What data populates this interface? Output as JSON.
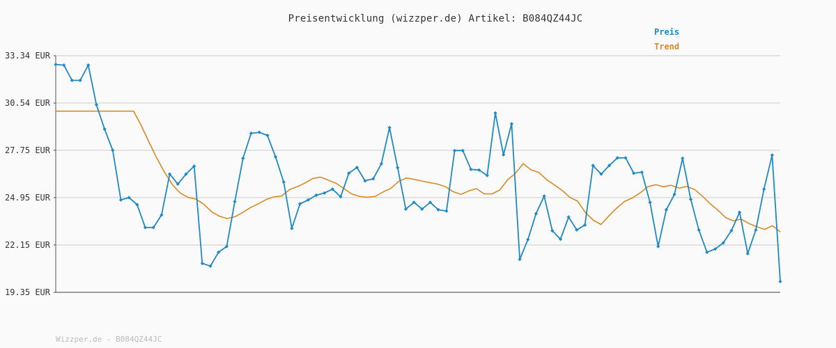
{
  "chart_data": {
    "type": "line",
    "title": "Preisentwicklung (wizzper.de) Artikel: B084QZ44JC",
    "ylim": [
      19.35,
      33.34
    ],
    "y_ticks": [
      "33.34 EUR",
      "30.54 EUR",
      "27.75 EUR",
      "24.95 EUR",
      "22.15 EUR",
      "19.35 EUR"
    ],
    "y_tick_values": [
      33.34,
      30.54,
      27.75,
      24.95,
      22.15,
      19.35
    ],
    "grid": true,
    "legend_position": "top-right",
    "series": [
      {
        "name": "Preis",
        "color": "#1f88c7",
        "marker": "diamond",
        "values": [
          32.82,
          32.78,
          31.88,
          31.88,
          32.78,
          30.44,
          29.0,
          27.75,
          24.81,
          24.95,
          24.53,
          23.18,
          23.18,
          23.92,
          26.34,
          25.75,
          26.34,
          26.81,
          21.06,
          20.9,
          21.72,
          22.06,
          24.72,
          27.27,
          28.75,
          28.81,
          28.63,
          27.36,
          25.87,
          23.13,
          24.58,
          24.81,
          25.09,
          25.22,
          25.45,
          25.0,
          26.39,
          26.73,
          25.94,
          26.06,
          26.95,
          29.09,
          26.72,
          24.27,
          24.67,
          24.27,
          24.67,
          24.23,
          24.16,
          27.73,
          27.73,
          26.62,
          26.58,
          26.26,
          29.95,
          27.48,
          29.31,
          21.3,
          22.47,
          24.0,
          25.04,
          22.99,
          22.49,
          23.8,
          23.04,
          23.33,
          26.85,
          26.34,
          26.85,
          27.3,
          27.3,
          26.39,
          26.45,
          24.67,
          22.06,
          24.23,
          25.14,
          27.27,
          24.85,
          23.04,
          21.72,
          21.91,
          22.27,
          23.0,
          24.08,
          21.64,
          23.04,
          25.45,
          27.46,
          19.99
        ]
      },
      {
        "name": "Trend",
        "color": "#d98a25",
        "marker": "none",
        "values": [
          30.06,
          30.06,
          30.06,
          30.06,
          30.06,
          30.06,
          30.06,
          30.06,
          30.06,
          30.06,
          30.06,
          29.19,
          28.2,
          27.26,
          26.42,
          25.7,
          25.21,
          24.96,
          24.86,
          24.56,
          24.11,
          23.85,
          23.71,
          23.82,
          24.07,
          24.36,
          24.58,
          24.83,
          24.99,
          25.05,
          25.42,
          25.6,
          25.81,
          26.08,
          26.16,
          25.98,
          25.79,
          25.48,
          25.17,
          25.02,
          24.97,
          25.02,
          25.28,
          25.49,
          25.9,
          26.11,
          26.03,
          25.93,
          25.84,
          25.75,
          25.6,
          25.3,
          25.14,
          25.34,
          25.48,
          25.17,
          25.17,
          25.4,
          26.0,
          26.38,
          26.96,
          26.59,
          26.44,
          26.02,
          25.7,
          25.38,
          24.96,
          24.74,
          24.06,
          23.61,
          23.36,
          23.87,
          24.33,
          24.72,
          24.93,
          25.22,
          25.59,
          25.71,
          25.59,
          25.68,
          25.51,
          25.61,
          25.43,
          25.04,
          24.59,
          24.21,
          23.76,
          23.57,
          23.68,
          23.41,
          23.22,
          23.07,
          23.29,
          22.92
        ]
      }
    ]
  },
  "footer": "Wizzper.de - B084QZ44JC"
}
